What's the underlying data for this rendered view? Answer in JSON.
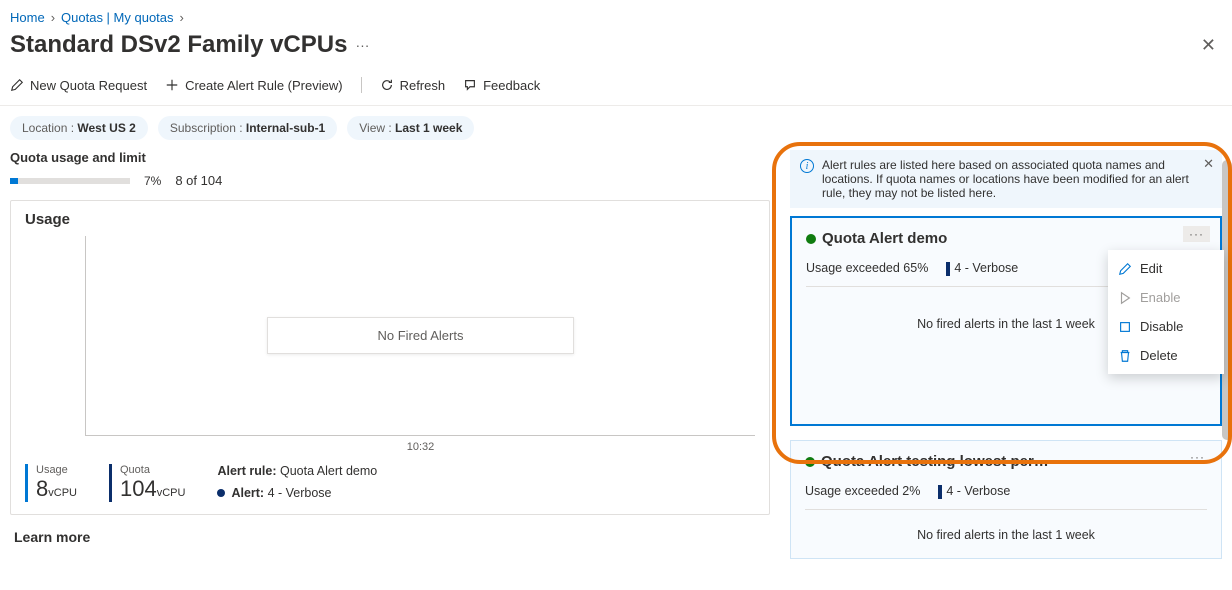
{
  "breadcrumb": {
    "home": "Home",
    "quotas": "Quotas | My quotas"
  },
  "page": {
    "title": "Standard DSv2 Family vCPUs"
  },
  "toolbar": {
    "new_quota": "New Quota Request",
    "create_alert": "Create Alert Rule (Preview)",
    "refresh": "Refresh",
    "feedback": "Feedback"
  },
  "filters": {
    "location_label": "Location : ",
    "location_value": "West US 2",
    "subscription_label": "Subscription : ",
    "subscription_value": "Internal-sub-1",
    "view_label": "View : ",
    "view_value": "Last 1 week"
  },
  "usage": {
    "section_title": "Quota usage and limit",
    "bar_percent": 7,
    "pct_text": "7%",
    "count_text": "8 of 104",
    "card_title": "Usage",
    "no_fired": "No Fired Alerts",
    "x_tick": "10:32",
    "usage_label": "Usage",
    "usage_value": "8",
    "usage_unit": "vCPU",
    "quota_label": "Quota",
    "quota_value": "104",
    "quota_unit": "vCPU",
    "alert_rule_label": "Alert rule:",
    "alert_rule_name": "Quota Alert demo",
    "alert_sev_label": "Alert:",
    "alert_sev_value": "4 - Verbose"
  },
  "learn_more": "Learn more",
  "info_banner": "Alert rules are listed here based on associated quota names and locations. If quota names or locations have been modified for an alert rule, they may not be listed here.",
  "alerts": [
    {
      "name": "Quota Alert demo",
      "condition": "Usage exceeded 65%",
      "severity": "4 - Verbose",
      "no_fired": "No fired alerts in the last 1 week"
    },
    {
      "name": "Quota Alert testing lowest per…",
      "condition": "Usage exceeded 2%",
      "severity": "4 - Verbose",
      "no_fired": "No fired alerts in the last 1 week"
    }
  ],
  "menu": {
    "edit": "Edit",
    "enable": "Enable",
    "disable": "Disable",
    "delete": "Delete"
  }
}
